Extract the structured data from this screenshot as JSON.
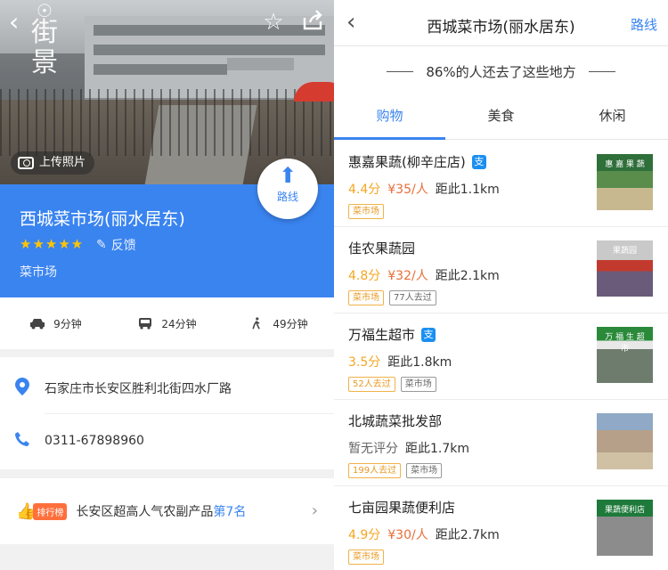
{
  "left": {
    "street_view_label": "街景",
    "upload_label": "上传照片",
    "route_button_label": "路线",
    "place": {
      "name": "西城菜市场(丽水居东)",
      "rating_stars": 5,
      "feedback_label": "反馈",
      "category": "菜市场"
    },
    "travel": [
      {
        "mode": "car",
        "time": "9分钟"
      },
      {
        "mode": "bus",
        "time": "24分钟"
      },
      {
        "mode": "walk",
        "time": "49分钟"
      }
    ],
    "address": "石家庄市长安区胜利北街四水厂路",
    "phone": "0311-67898960",
    "rank": {
      "tag": "排行榜",
      "text": "长安区超高人气农副产品",
      "position": "第7名"
    }
  },
  "right": {
    "title": "西城菜市场(丽水居东)",
    "route_label": "路线",
    "banner": "86%的人还去了这些地方",
    "tabs": [
      "购物",
      "美食",
      "休闲"
    ],
    "active_tab": 0,
    "items": [
      {
        "name": "惠嘉果蔬(柳辛庄店)",
        "alipay": true,
        "score": "4.4分",
        "price": "¥35/人",
        "distance": "距此1.1km",
        "tags": [
          {
            "text": "菜市场",
            "style": "orange"
          }
        ],
        "sign": "惠 嘉 果 蔬"
      },
      {
        "name": "佳农果蔬园",
        "alipay": false,
        "score": "4.8分",
        "price": "¥32/人",
        "distance": "距此2.1km",
        "tags": [
          {
            "text": "菜市场",
            "style": "orange"
          },
          {
            "text": "77人去过",
            "style": "grey"
          }
        ],
        "sign": "果蔬园"
      },
      {
        "name": "万福生超市",
        "alipay": true,
        "score": "3.5分",
        "price": "",
        "distance": "距此1.8km",
        "tags": [
          {
            "text": "52人去过",
            "style": "orange"
          },
          {
            "text": "菜市场",
            "style": "grey"
          }
        ],
        "sign": "万 福 生 超 市"
      },
      {
        "name": "北城蔬菜批发部",
        "alipay": false,
        "score": "暂无评分",
        "price": "",
        "distance": "距此1.7km",
        "tags": [
          {
            "text": "199人去过",
            "style": "orange"
          },
          {
            "text": "菜市场",
            "style": "grey"
          }
        ],
        "sign": ""
      },
      {
        "name": "七亩园果蔬便利店",
        "alipay": false,
        "score": "4.9分",
        "price": "¥30/人",
        "distance": "距此2.7km",
        "tags": [
          {
            "text": "菜市场",
            "style": "orange"
          }
        ],
        "sign": "果蔬便利店"
      }
    ]
  },
  "colors": {
    "accent": "#3a84f0",
    "score": "#f5a623",
    "price": "#e86f3a"
  }
}
